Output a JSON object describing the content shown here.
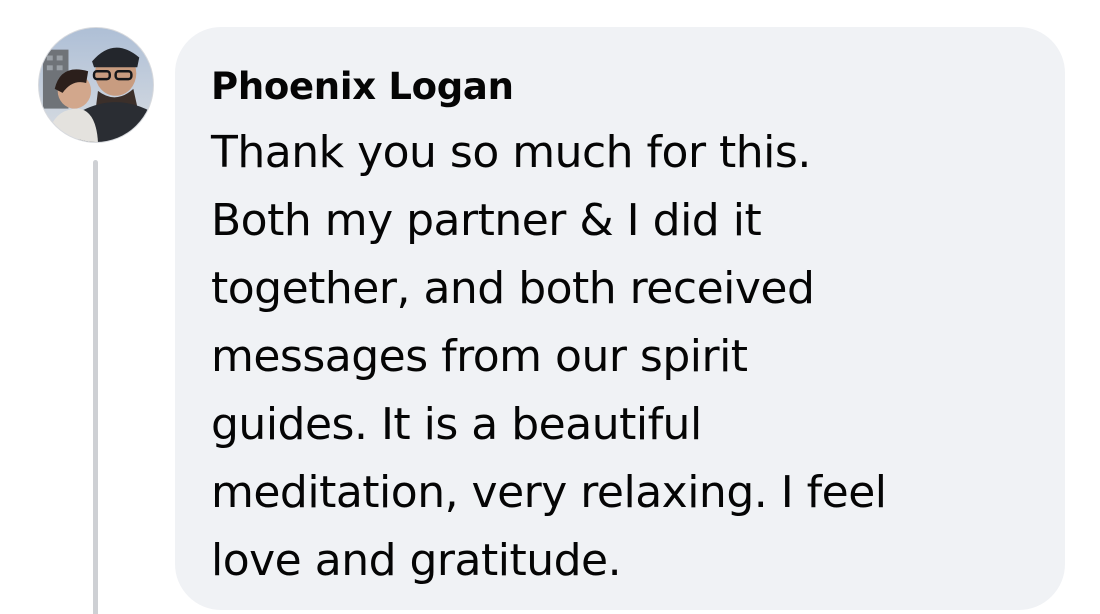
{
  "comment": {
    "author": "Phoenix Logan",
    "lines": [
      "Thank you so much for this.",
      "Both my partner & I did it",
      "together, and both received",
      "messages from our spirit",
      "guides. It is a beautiful",
      "meditation, very relaxing. I feel",
      "love and gratitude."
    ]
  },
  "colors": {
    "bubble_background": "#f0f2f5",
    "text": "#050505",
    "thread_line": "#ced0d4"
  },
  "icons": {
    "avatar": "profile-photo"
  }
}
